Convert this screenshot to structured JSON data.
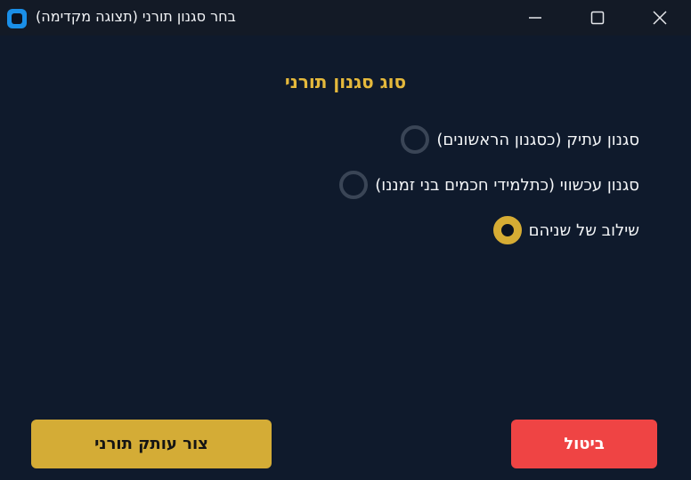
{
  "window": {
    "title": "בחר סגנון תורני (תצוגה מקדימה)",
    "app_icon": "app-icon"
  },
  "titlebar_buttons": {
    "minimize": "minimize-icon",
    "maximize": "maximize-icon",
    "close": "close-icon"
  },
  "dialog": {
    "heading": "סוג סגנון תורני",
    "options": [
      {
        "label": "סגנון עתיק (כסגנון הראשונים)",
        "selected": false
      },
      {
        "label": "סגנון עכשווי (כתלמידי חכמים בני זמננו)",
        "selected": false
      },
      {
        "label": "שילוב של שניהם",
        "selected": true
      }
    ],
    "create_button": "צור עותק תורני",
    "cancel_button": "ביטול"
  },
  "colors": {
    "background": "#0f1a2c",
    "titlebar": "#131a26",
    "accent": "#d4ac36",
    "heading": "#e5b93c",
    "cancel": "#ef4444"
  }
}
